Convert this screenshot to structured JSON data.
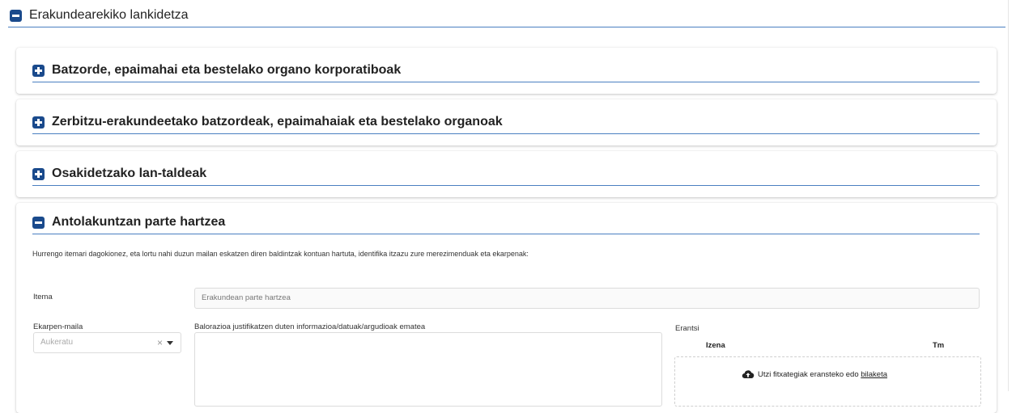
{
  "section": {
    "title": "Erakundearekiko lankidetza"
  },
  "panels": [
    {
      "title": "Batzorde, epaimahai eta bestelako organo korporatiboak"
    },
    {
      "title": "Zerbitzu-erakundeetako batzordeak, epaimahaiak eta bestelako organoak"
    },
    {
      "title": "Osakidetzako lan-taldeak"
    }
  ],
  "active_panel": {
    "title": "Antolakuntzan parte hartzea",
    "intro": "Hurrengo itemari dagokionez, eta lortu nahi duzun mailan eskatzen diren baldintzak kontuan hartuta, identifika itzazu zure merezimenduak eta ekarpenak:",
    "item_label": "Itema",
    "item_value": "Erakundean parte hartzea",
    "level_label": "Ekarpen-maila",
    "level_placeholder": "Aukeratu",
    "level_clear": "×",
    "justification_label": "Balorazioa justifikatzen duten informazioa/datuak/argudioak ematea",
    "attach_label": "Erantsi",
    "col_name": "Izena",
    "col_size": "Tm",
    "drop_text": "Utzi fitxategiak eransteko edo ",
    "drop_link": "bilaketa"
  },
  "colors": {
    "accent": "#1a4a8c",
    "underline": "#4a7fc1"
  },
  "icons": {
    "collapse": "minus-square-icon",
    "expand": "plus-square-icon",
    "upload": "cloud-upload-icon"
  }
}
